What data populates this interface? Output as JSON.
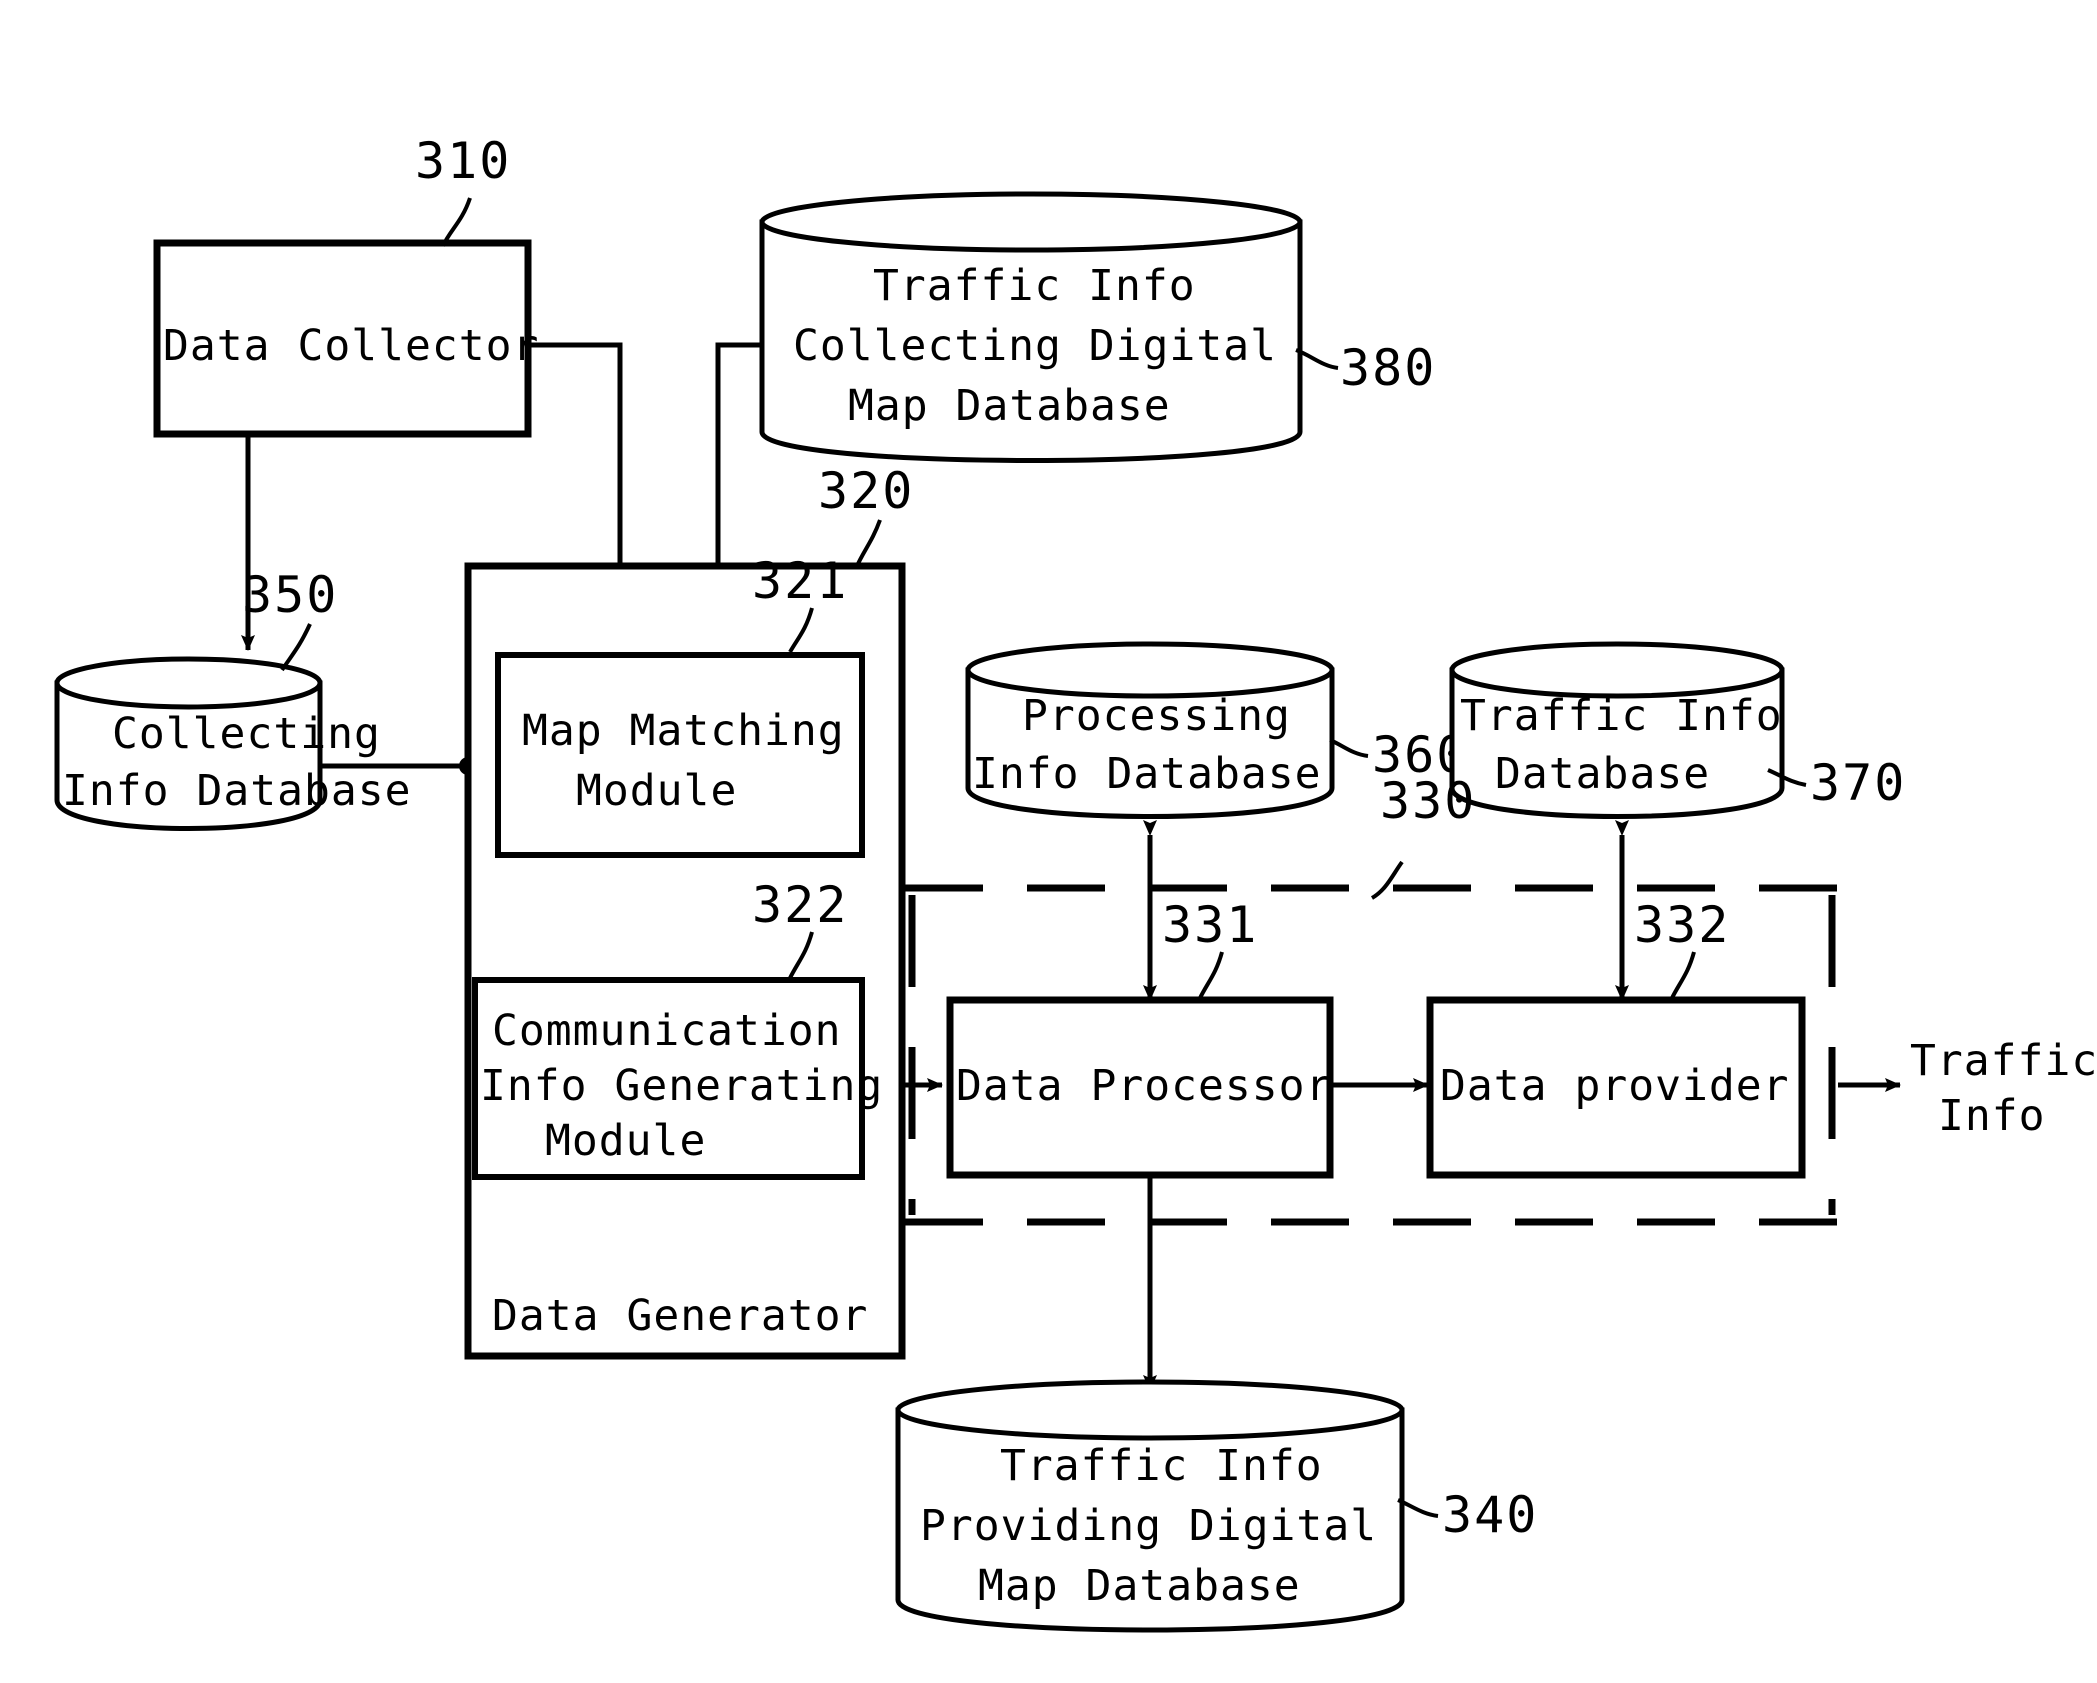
{
  "figure": {
    "title": "Traffic information system block diagram",
    "stroke_color": "#000000",
    "background_color": "#ffffff"
  },
  "blocks": {
    "data_collector": {
      "label": "Data Collector",
      "ref": "310"
    },
    "data_generator": {
      "label": "Data Generator",
      "ref": "320"
    },
    "map_matching_module": {
      "label_line1": "Map Matching",
      "label_line2": "Module",
      "ref": "321"
    },
    "communication_info_generating_module": {
      "label_line1": "Communication",
      "label_line2": "Info Generating",
      "label_line3": "Module",
      "ref": "322"
    },
    "data_processor": {
      "label": "Data Processor",
      "ref": "331"
    },
    "data_provider": {
      "label": "Data provider",
      "ref": "332"
    },
    "processing_group": {
      "ref": "330"
    }
  },
  "databases": {
    "collecting_info_database": {
      "label_line1": "Collecting",
      "label_line2": "Info Database",
      "ref": "350"
    },
    "traffic_info_collecting_digital_map_database": {
      "label_line1": "Traffic Info",
      "label_line2": "Collecting Digital",
      "label_line3": "Map Database",
      "ref": "380"
    },
    "processing_info_database": {
      "label_line1": "Processing",
      "label_line2": "Info Database",
      "ref": "360"
    },
    "traffic_info_database": {
      "label_line1": "Traffic Info",
      "label_line2": "Database",
      "ref": "370"
    },
    "traffic_info_providing_digital_map_database": {
      "label_line1": "Traffic Info",
      "label_line2": "Providing Digital",
      "label_line3": "Map Database",
      "ref": "340"
    }
  },
  "outputs": {
    "traffic_info_output": {
      "label_line1": "Traffic",
      "label_line2": "Info"
    }
  }
}
